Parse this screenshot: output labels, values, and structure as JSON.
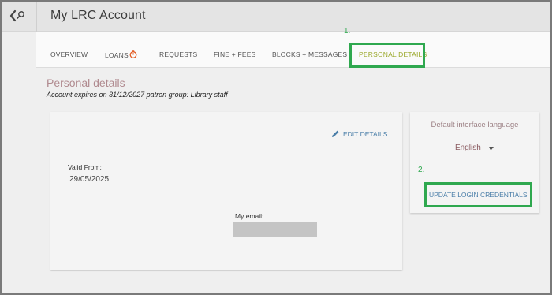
{
  "header": {
    "title": "My LRC Account"
  },
  "tabs": [
    {
      "label": "OVERVIEW"
    },
    {
      "label": "LOANS"
    },
    {
      "label": "REQUESTS"
    },
    {
      "label": "FINE + FEES"
    },
    {
      "label": "BLOCKS + MESSAGES"
    },
    {
      "label": "PERSONAL DETAILS",
      "active": true
    }
  ],
  "annotations": {
    "step1": "1.",
    "step2": "2.",
    "color": "#2fa84f"
  },
  "section": {
    "title": "Personal details",
    "subtitle": "Account expires on 31/12/2027 patron group: Library staff"
  },
  "details_card": {
    "edit_label": "EDIT DETAILS",
    "valid_from_label": "Valid From:",
    "valid_from_value": "29/05/2025",
    "email_label": "My email:"
  },
  "language_card": {
    "heading": "Default interface language",
    "selected_language": "English",
    "update_credentials_label": "UPDATE LOGIN CREDENTIALS"
  },
  "colors": {
    "accent": "#9aa82a",
    "link": "#4a7ea8",
    "heading": "#b08a8f",
    "loans_clock": "#e2581f"
  },
  "icons": [
    "back-arrow-icon",
    "search-icon",
    "clock-icon",
    "pencil-icon",
    "caret-down-icon"
  ]
}
